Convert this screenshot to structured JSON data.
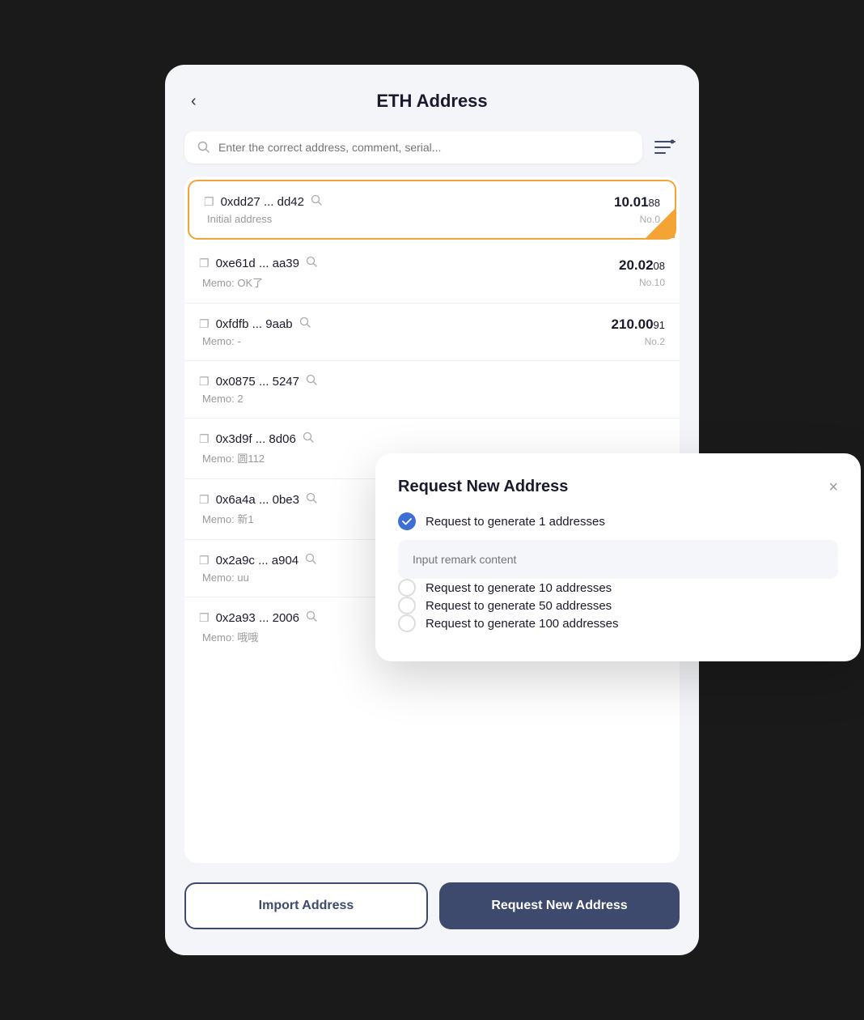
{
  "page": {
    "title": "ETH Address",
    "back_label": "‹",
    "search": {
      "placeholder": "Enter the correct address, comment, serial..."
    }
  },
  "addresses": [
    {
      "hash": "0xdd27 ... dd42",
      "memo": "Initial address",
      "amount_main": "10.01",
      "amount_small": "88",
      "no": "No.0",
      "selected": true
    },
    {
      "hash": "0xe61d ... aa39",
      "memo": "Memo: OK了",
      "amount_main": "20.02",
      "amount_small": "08",
      "no": "No.10",
      "selected": false
    },
    {
      "hash": "0xfdfb ... 9aab",
      "memo": "Memo: -",
      "amount_main": "210.00",
      "amount_small": "91",
      "no": "No.2",
      "selected": false
    },
    {
      "hash": "0x0875 ... 5247",
      "memo": "Memo: 2",
      "amount_main": "",
      "amount_small": "",
      "no": "",
      "selected": false
    },
    {
      "hash": "0x3d9f ... 8d06",
      "memo": "Memo: 圆112",
      "amount_main": "",
      "amount_small": "",
      "no": "",
      "selected": false
    },
    {
      "hash": "0x6a4a ... 0be3",
      "memo": "Memo: 新1",
      "amount_main": "",
      "amount_small": "",
      "no": "",
      "selected": false
    },
    {
      "hash": "0x2a9c ... a904",
      "memo": "Memo: uu",
      "amount_main": "",
      "amount_small": "",
      "no": "",
      "selected": false
    },
    {
      "hash": "0x2a93 ... 2006",
      "memo": "Memo: 哦哦",
      "amount_main": "",
      "amount_small": "",
      "no": "",
      "selected": false
    }
  ],
  "buttons": {
    "import": "Import Address",
    "request": "Request New Address"
  },
  "modal": {
    "title": "Request New Address",
    "close_label": "×",
    "remark_placeholder": "Input remark content",
    "options": [
      {
        "label": "Request to generate 1 addresses",
        "checked": true
      },
      {
        "label": "Request to generate 10 addresses",
        "checked": false
      },
      {
        "label": "Request to generate 50 addresses",
        "checked": false
      },
      {
        "label": "Request to generate 100 addresses",
        "checked": false
      }
    ]
  }
}
